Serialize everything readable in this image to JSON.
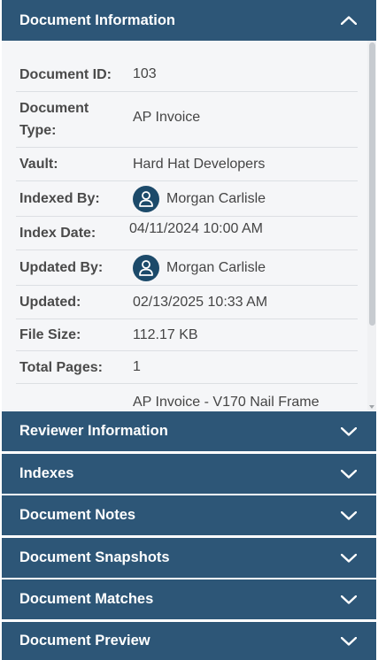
{
  "document_information": {
    "title": "Document Information",
    "rows": [
      {
        "label": "Document ID:",
        "value": "103"
      },
      {
        "label_line1": "Document",
        "label_line2": "Type:",
        "value": "AP Invoice"
      },
      {
        "label": "Vault:",
        "value": "Hard Hat Developers"
      },
      {
        "label": "Indexed By:",
        "value": "Morgan Carlisle",
        "icon": "user-avatar-icon"
      },
      {
        "label": "Index Date:",
        "value": "04/11/2024 10:00 AM"
      },
      {
        "label": "Updated By:",
        "value": "Morgan Carlisle",
        "icon": "user-avatar-icon"
      },
      {
        "label": "Updated:",
        "value": "02/13/2025 10:33 AM"
      },
      {
        "label": "File Size:",
        "value": "112.17 KB"
      },
      {
        "label": "Total Pages:",
        "value": "1"
      },
      {
        "label": "",
        "value": "AP Invoice - V170 Nail Frame"
      }
    ]
  },
  "sections": [
    {
      "label": "Reviewer Information",
      "icon": "chevron-down-icon"
    },
    {
      "label": "Indexes",
      "icon": "chevron-down-icon"
    },
    {
      "label": "Document Notes",
      "icon": "chevron-down-icon"
    },
    {
      "label": "Document Snapshots",
      "icon": "chevron-down-icon"
    },
    {
      "label": "Document Matches",
      "icon": "chevron-down-icon"
    },
    {
      "label": "Document Preview",
      "icon": "chevron-down-icon"
    }
  ],
  "colors": {
    "header_bg": "#2d5677",
    "avatar_bg": "#1c4a6a",
    "body_bg": "#f5f6f8"
  }
}
